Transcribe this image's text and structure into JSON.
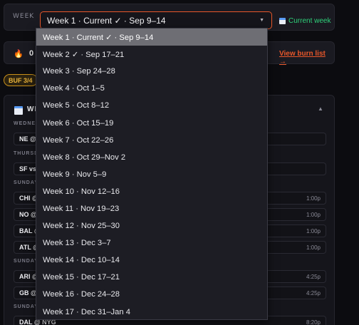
{
  "header": {
    "week_label": "WEEK",
    "selected_week": "Week 1 · Current ✓ · Sep 9–14",
    "current_week_link": "Current week"
  },
  "burn": {
    "count": "0",
    "view_link": "View burn list →"
  },
  "buffer_badge": "BUF 3/4",
  "games_panel": {
    "title_visible": "WE",
    "days": [
      {
        "label": "WEDNES",
        "games": [
          {
            "matchup": "NE @",
            "time": ""
          }
        ]
      },
      {
        "label": "THURSD",
        "games": [
          {
            "matchup": "SF vs",
            "time": ""
          }
        ]
      },
      {
        "label": "SUNDAY",
        "games": [
          {
            "matchup": "CHI @",
            "time": "1:00p"
          },
          {
            "matchup": "NO @",
            "time": "1:00p"
          },
          {
            "matchup": "BAL @",
            "time": "1:00p"
          },
          {
            "matchup": "ATL @",
            "time": "1:00p"
          }
        ]
      },
      {
        "label": "SUNDAY",
        "games": [
          {
            "matchup": "ARI @",
            "time": "4:25p"
          },
          {
            "matchup": "GB @",
            "time": "4:25p"
          }
        ]
      },
      {
        "label": "SUNDAY",
        "games": [
          {
            "matchup": "DAL @ NYG",
            "time": "8:20p"
          }
        ]
      }
    ]
  },
  "dropdown": {
    "options": [
      "Week 1 · Current ✓ · Sep 9–14",
      "Week 2 ✓ · Sep 17–21",
      "Week 3 · Sep 24–28",
      "Week 4 · Oct 1–5",
      "Week 5 · Oct 8–12",
      "Week 6 · Oct 15–19",
      "Week 7 · Oct 22–26",
      "Week 8 · Oct 29–Nov 2",
      "Week 9 · Nov 5–9",
      "Week 10 · Nov 12–16",
      "Week 11 · Nov 19–23",
      "Week 12 · Nov 25–30",
      "Week 13 · Dec 3–7",
      "Week 14 · Dec 10–14",
      "Week 15 · Dec 17–21",
      "Week 16 · Dec 24–28",
      "Week 17 · Dec 31–Jan 4"
    ],
    "selected_index": 0
  },
  "colors": {
    "accent": "#e8572a",
    "current_week_green": "#2fd17a",
    "badge_gold": "#e8b23a"
  },
  "icons": [
    "calendar-icon",
    "chevron-down-icon",
    "flame-icon",
    "chevron-up-icon"
  ]
}
